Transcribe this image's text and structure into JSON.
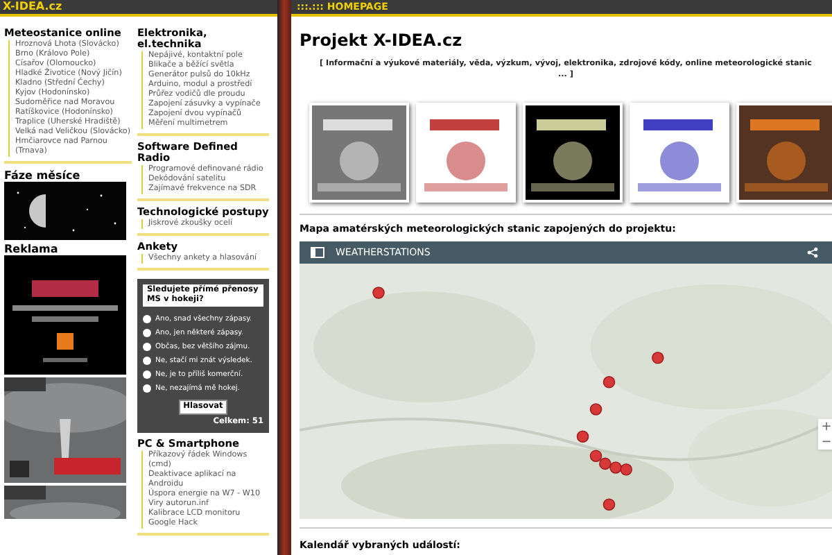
{
  "site_title": "X-IDEA.cz",
  "left_column": [
    {
      "kind": "links",
      "heading": "Meteostanice online",
      "links": [
        "Hroznová Lhota (Slovácko)",
        "Brno (Královo Pole)",
        "Císařov (Olomoucko)",
        "Hladké Životice (Nový Jičín)",
        "Kladno (Střední Čechy)",
        "Kyjov (Hodonínsko)",
        "Sudoměřice nad Moravou",
        "Ratíškovice (Hodonínsko)",
        "Traplice (Uherské Hradiště)",
        "Velká nad Veličkou (Slovácko)",
        "Hmčiarovce nad Parnou (Trnava)"
      ]
    },
    {
      "kind": "moon",
      "heading": "Fáze měsíce"
    },
    {
      "kind": "ads",
      "heading": "Reklama"
    }
  ],
  "right_column": [
    {
      "kind": "links",
      "heading": "Elektronika, el.technika",
      "links": [
        "Nepájivé, kontaktní pole",
        "Blikače a běžící světla",
        "Generátor pulsů do 10kHz",
        "Arduino, modul a prostředí",
        "Průřez vodičů dle proudu",
        "Zapojení zásuvky a vypínače",
        "Zapojení dvou vypínačů",
        "Měření multimetrem"
      ]
    },
    {
      "kind": "links",
      "heading": "Software Defined Radio",
      "links": [
        "Programové definované rádio",
        "Dekódování satelitu",
        "Zajímavé frekvence na SDR"
      ]
    },
    {
      "kind": "links",
      "heading": "Technologické postupy",
      "links": [
        "Jiskrové zkoušky ocelí"
      ]
    },
    {
      "kind": "links",
      "heading": "Ankety",
      "links": [
        "Všechny ankety a hlasování"
      ]
    },
    {
      "kind": "poll",
      "question": "Sledujete přímé přenosy MS v hokeji?",
      "options": [
        {
          "label": "Ano, snad všechny zápasy.",
          "selected": false
        },
        {
          "label": "Ano, jen některé zápasy.",
          "selected": false
        },
        {
          "label": "Občas, bez většího zájmu.",
          "selected": false
        },
        {
          "label": "Ne, stačí mi znát výsledek.",
          "selected": false
        },
        {
          "label": "Ne, je to příliš komerční.",
          "selected": false
        },
        {
          "label": "Ne, nezajímá mě hokej.",
          "selected": false
        }
      ],
      "button": "Hlasovat",
      "total": "Celkem: 51"
    },
    {
      "kind": "links",
      "heading": "PC & Smartphone",
      "links": [
        "Příkazový řádek Windows (cmd)",
        "Deaktivace aplikací na Androidu",
        "Úspora energie na W7 - W10",
        "Viry autorun.inf",
        "Kalibrace LCD monitoru",
        "Google Hack"
      ]
    }
  ],
  "main": {
    "header": ":::.::: HOMEPAGE",
    "title": "Projekt X-IDEA.cz",
    "subtitle_lines": [
      "[ Informační a výukové materiály, věda, výzkum, vývoj, elektronika, zdrojové kódy, online meteorologické stanic",
      "... ]"
    ],
    "thumbnails": [
      {
        "kind": "picture"
      },
      {
        "kind": "picture"
      },
      {
        "kind": "picture"
      },
      {
        "kind": "picture"
      },
      {
        "kind": "picture"
      }
    ],
    "map_heading": "Mapa amatérských meteorologických stanic zapojených do projektu:",
    "map": {
      "title": "WEATHERSTATIONS",
      "zoom_in": "+",
      "zoom_out": "−"
    },
    "calendar_heading": "Kalendář vybraných událostí:"
  }
}
